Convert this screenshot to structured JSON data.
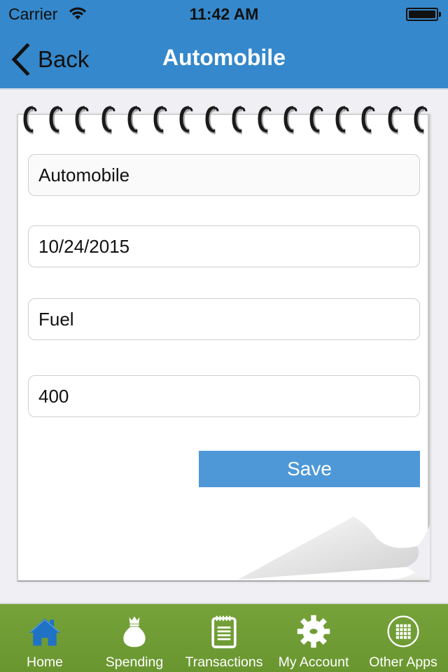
{
  "status_bar": {
    "carrier": "Carrier",
    "time": "11:42 AM",
    "battery_level": 1.0
  },
  "nav": {
    "back_label": "Back",
    "title": "Automobile"
  },
  "form": {
    "category": "Automobile",
    "date": "10/24/2015",
    "description": "Fuel",
    "amount": "400",
    "save_label": "Save"
  },
  "notebook": {
    "ring_count": 16
  },
  "tabbar": {
    "items": [
      {
        "label": "Home",
        "icon": "home-icon",
        "active": true
      },
      {
        "label": "Spending",
        "icon": "money-bag-icon",
        "active": false
      },
      {
        "label": "Transactions",
        "icon": "notepad-icon",
        "active": false
      },
      {
        "label": "My Account",
        "icon": "gear-icon",
        "active": false
      },
      {
        "label": "Other Apps",
        "icon": "apps-grid-icon",
        "active": false
      }
    ]
  },
  "colors": {
    "header": "#3588cb",
    "save_button": "#4e98d8",
    "tabbar": "#72a036",
    "active_tab_icon": "#1f72c4"
  }
}
